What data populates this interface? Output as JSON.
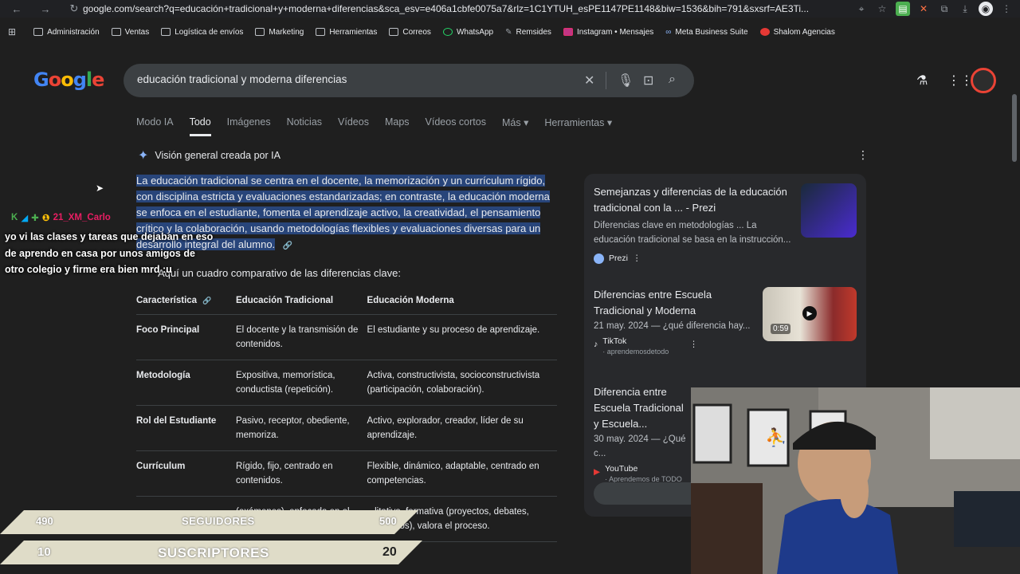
{
  "browser": {
    "url": "google.com/search?q=educación+tradicional+y+moderna+diferencias&sca_esv=e406a1cbfe0075a7&rlz=1C1YTUH_esPE1147PE1148&biw=1536&bih=791&sxsrf=AE3Ti...",
    "bookmarks": [
      "Administración",
      "Ventas",
      "Logística de envíos",
      "Marketing",
      "Herramientas",
      "Correos",
      "WhatsApp",
      "Remsides",
      "Instagram • Mensajes",
      "Meta Business Suite",
      "Shalom Agencias"
    ]
  },
  "search": {
    "logo": "Google",
    "query": "educación tradicional y moderna diferencias",
    "tabs": [
      "Modo IA",
      "Todo",
      "Imágenes",
      "Noticias",
      "Vídeos",
      "Maps",
      "Vídeos cortos",
      "Más ▾",
      "Herramientas ▾"
    ]
  },
  "ai_overview": {
    "heading": "Visión general creada por IA",
    "paragraph": "La educación tradicional se centra en el docente, la memorización y un currículum rígido, con disciplina estricta y evaluaciones estandarizadas; en contraste, la educación moderna se enfoca en el estudiante, fomenta el aprendizaje activo, la creatividad, el pensamiento crítico y la colaboración, usando metodologías flexibles y evaluaciones diversas para un desarrollo integral del alumno.",
    "lead": "Aquí un cuadro comparativo de las diferencias clave:",
    "table": {
      "headers": [
        "Característica",
        "Educación Tradicional",
        "Educación Moderna"
      ],
      "rows": [
        [
          "Foco Principal",
          "El docente y la transmisión de contenidos.",
          "El estudiante y su proceso de aprendizaje."
        ],
        [
          "Metodología",
          "Expositiva, memorística, conductista (repetición).",
          "Activa, constructivista, socioconstructivista (participación, colaboración)."
        ],
        [
          "Rol del Estudiante",
          "Pasivo, receptor, obediente, memoriza.",
          "Activo, explorador, creador, líder de su aprendizaje."
        ],
        [
          "Currículum",
          "Rígido, fijo, centrado en contenidos.",
          "Flexible, dinámico, adaptable, centrado en competencias."
        ],
        [
          "",
          "(exámenes), enfocada en el resultado.",
          "...litativa, formativa (proyectos, debates, portafolios), valora el proceso."
        ]
      ]
    }
  },
  "sources": [
    {
      "title": "Semejanzas y diferencias de la educación tradicional con la ... - Prezi",
      "snippet": "Diferencias clave en metodologías ... La educación tradicional se basa en la instrucción...",
      "source": "Prezi"
    },
    {
      "title": "Diferencias entre Escuela Tradicional y Moderna",
      "snippet": "21 may. 2024 — ¿qué diferencia hay...",
      "source": "TikTok",
      "sub": "· aprendemosdetodo",
      "duration": "0:59"
    },
    {
      "title": "Diferencia entre Escuela Tradicional y Escuela...",
      "snippet": "30 may. 2024 — ¿Qué c...",
      "source": "YouTube",
      "sub": "· Aprendemos de TODO"
    }
  ],
  "stream": {
    "chat_user": "21_XM_Carlo",
    "chat_message": "yo vi las clases y tareas que dejaban en eso de aprendo en casa por unos amigos de otro colegio y firme era bien mrd :u",
    "followers": {
      "current": "490",
      "label": "SEGUIDORES",
      "goal": "500"
    },
    "subscribers": {
      "current": "10",
      "label": "SUSCRIPTORES",
      "goal": "20"
    }
  }
}
